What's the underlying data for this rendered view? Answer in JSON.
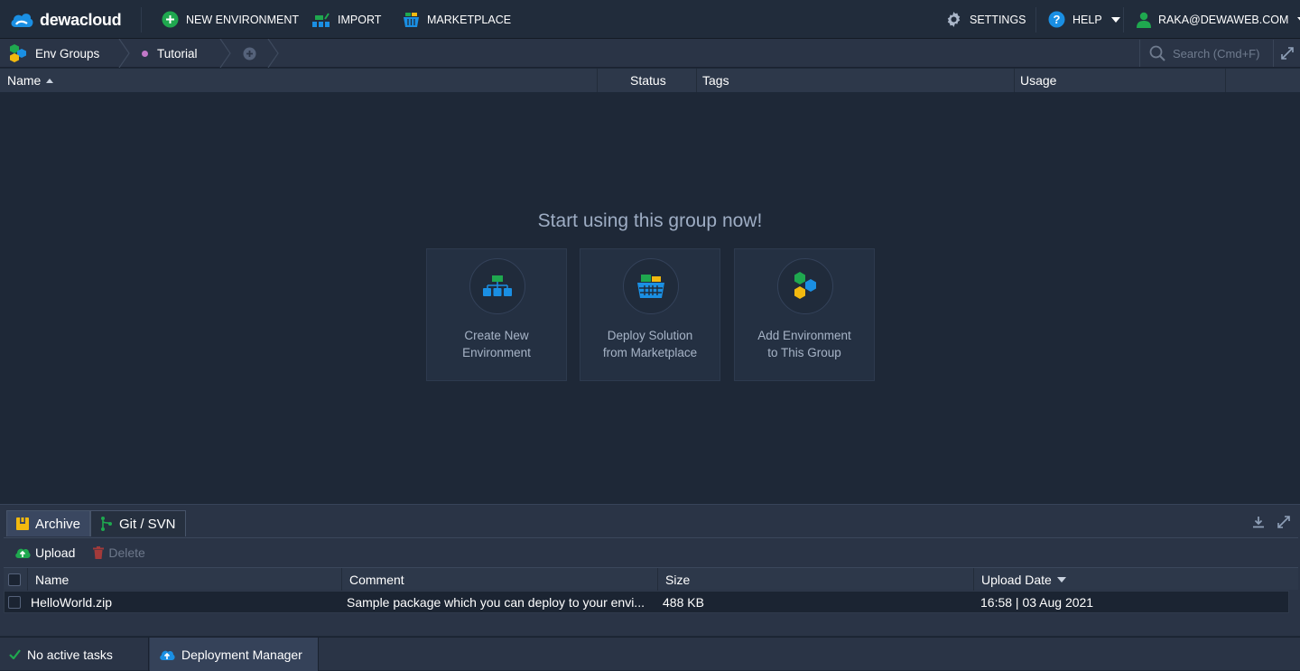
{
  "app": {
    "brand": "dewacloud"
  },
  "topbar": {
    "new_environment": "NEW ENVIRONMENT",
    "import": "IMPORT",
    "marketplace": "MARKETPLACE",
    "settings": "SETTINGS",
    "help": "HELP",
    "user": "RAKA@DEWAWEB.COM"
  },
  "breadcrumb": {
    "env_groups": "Env Groups",
    "current": "Tutorial"
  },
  "search": {
    "placeholder": "Search (Cmd+F)"
  },
  "grid": {
    "columns": [
      "Name",
      "Status",
      "Tags",
      "Usage"
    ]
  },
  "empty_state": {
    "title": "Start using this group now!",
    "cards": [
      {
        "line1": "Create New",
        "line2": "Environment"
      },
      {
        "line1": "Deploy Solution",
        "line2": "from Marketplace"
      },
      {
        "line1": "Add Environment",
        "line2": "to This Group"
      }
    ]
  },
  "bottom_panel": {
    "tabs": [
      "Archive",
      "Git / SVN"
    ],
    "toolbar": {
      "upload": "Upload",
      "delete": "Delete"
    },
    "columns": [
      "Name",
      "Comment",
      "Size",
      "Upload Date"
    ],
    "rows": [
      {
        "name": "HelloWorld.zip",
        "comment": "Sample package which you can deploy to your envi...",
        "size": "488 KB",
        "date": "16:58 | 03 Aug 2021"
      }
    ]
  },
  "statusbar": {
    "tasks": "No active tasks",
    "deployment_manager": "Deployment Manager"
  },
  "colors": {
    "accent_green": "#1fa84f",
    "accent_blue": "#1a8fe3",
    "accent_yellow": "#f2b90f",
    "bg": "#1e2837"
  }
}
